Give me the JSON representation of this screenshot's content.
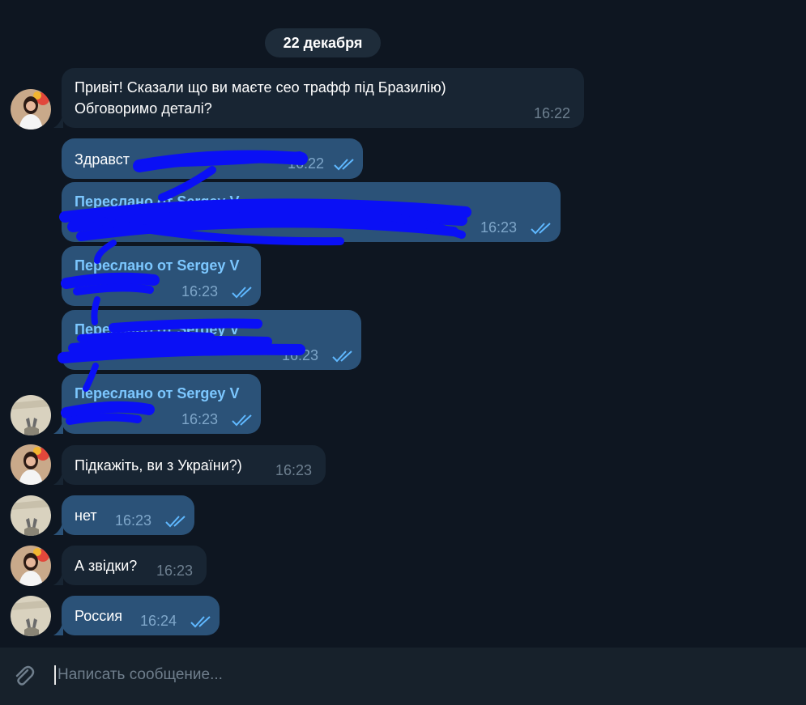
{
  "chat": {
    "date_label": "22 декабря",
    "messages": [
      {
        "direction": "in",
        "text_line1": "Привіт! Сказали що ви маєте сео трафф під Бразилію)",
        "text_line2": "Обговоримо деталі?",
        "time": "16:22"
      },
      {
        "direction": "out",
        "text": "Здравст",
        "time": "16:22",
        "status": "read"
      },
      {
        "direction": "out",
        "forwarded_from": "Переслано от Sergey V",
        "time": "16:23",
        "status": "read"
      },
      {
        "direction": "out",
        "forwarded_from": "Переслано от Sergey V",
        "time": "16:23",
        "status": "read"
      },
      {
        "direction": "out",
        "forwarded_from": "Переслано от Sergey V",
        "time": "16:23",
        "status": "read"
      },
      {
        "direction": "out",
        "forwarded_from": "Переслано от Sergey V",
        "time": "16:23",
        "status": "read"
      },
      {
        "direction": "in",
        "text": "Підкажіть, ви з України?)",
        "time": "16:23"
      },
      {
        "direction": "out",
        "text": "нет",
        "time": "16:23",
        "status": "read"
      },
      {
        "direction": "in",
        "text": "А звідки?",
        "time": "16:23"
      },
      {
        "direction": "out",
        "text": "Россия",
        "time": "16:24",
        "status": "read"
      }
    ]
  },
  "composer": {
    "placeholder": "Написать сообщение...",
    "value": "",
    "attach_icon": "paperclip-icon"
  },
  "colors": {
    "background": "#0e1621",
    "incoming_bubble": "#182533",
    "outgoing_bubble": "#2b5278",
    "forward_header": "#7cc7ff",
    "read_check": "#5fb8ff",
    "redaction": "#0a10f5"
  }
}
